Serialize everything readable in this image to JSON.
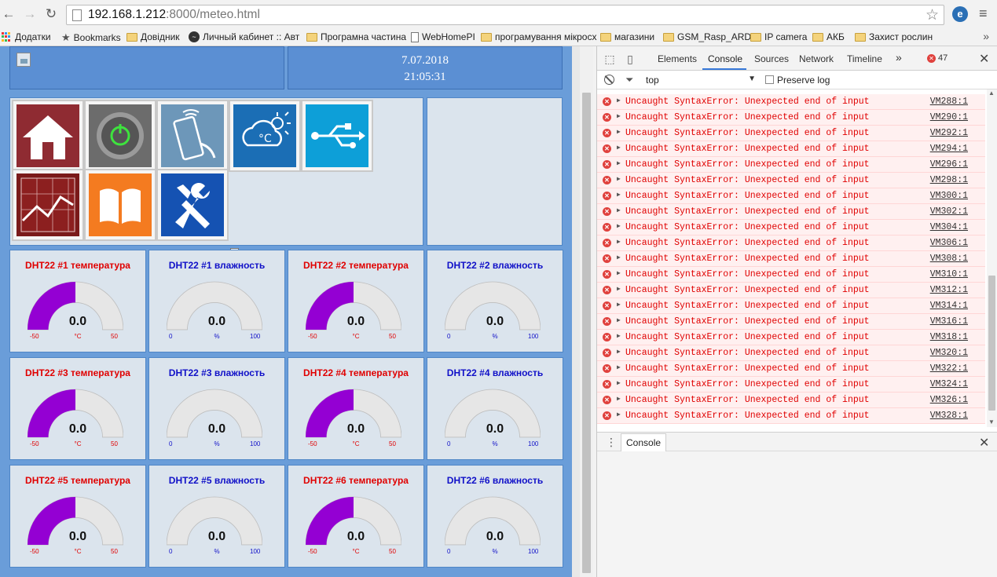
{
  "browser": {
    "url_host": "192.168.1.212",
    "url_rest": ":8000/meteo.html",
    "bookmarks": [
      {
        "label": "Додатки",
        "icon": "apps-icon"
      },
      {
        "label": "Bookmarks",
        "icon": "star-icon"
      },
      {
        "label": "Довідник",
        "icon": "folder-icon"
      },
      {
        "label": "Личный кабинет :: Авт",
        "icon": "globe-icon"
      },
      {
        "label": "Програмна частина",
        "icon": "folder-icon"
      },
      {
        "label": "WebHomePI",
        "icon": "page-icon"
      },
      {
        "label": "програмування мікросх",
        "icon": "folder-icon"
      },
      {
        "label": "магазини",
        "icon": "folder-icon"
      },
      {
        "label": "GSM_Rasp_ARD",
        "icon": "folder-icon"
      },
      {
        "label": "IP camera",
        "icon": "folder-icon"
      },
      {
        "label": "АКБ",
        "icon": "folder-icon"
      },
      {
        "label": "Захист рослин",
        "icon": "folder-icon"
      }
    ],
    "more_bookmarks": "»"
  },
  "page": {
    "date": "7.07.2018",
    "time": "21:05:31",
    "tiles": [
      {
        "name": "home",
        "color": "#8f2b32"
      },
      {
        "name": "power",
        "color": "#6c6c6c"
      },
      {
        "name": "remote",
        "color": "#6d97b9"
      },
      {
        "name": "weather",
        "color": "#1b6eb5"
      },
      {
        "name": "usb",
        "color": "#0d9fd8"
      },
      {
        "name": "chart",
        "color": "#7a1a1a"
      },
      {
        "name": "book",
        "color": "#f47b20"
      },
      {
        "name": "tools",
        "color": "#1552b2"
      }
    ],
    "gauges": [
      {
        "title": "DHT22 #1 температура",
        "kind": "temp",
        "value": "0.0",
        "min": "-50",
        "max": "50",
        "unit": "°C",
        "fill": 0.5
      },
      {
        "title": "DHT22 #1 влажность",
        "kind": "hum",
        "value": "0.0",
        "min": "0",
        "max": "100",
        "unit": "%",
        "fill": 0.0
      },
      {
        "title": "DHT22 #2 температура",
        "kind": "temp",
        "value": "0.0",
        "min": "-50",
        "max": "50",
        "unit": "°C",
        "fill": 0.5
      },
      {
        "title": "DHT22 #2 влажность",
        "kind": "hum",
        "value": "0.0",
        "min": "0",
        "max": "100",
        "unit": "%",
        "fill": 0.0
      },
      {
        "title": "DHT22 #3 температура",
        "kind": "temp",
        "value": "0.0",
        "min": "-50",
        "max": "50",
        "unit": "°C",
        "fill": 0.5
      },
      {
        "title": "DHT22 #3 влажность",
        "kind": "hum",
        "value": "0.0",
        "min": "0",
        "max": "100",
        "unit": "%",
        "fill": 0.0
      },
      {
        "title": "DHT22 #4 температура",
        "kind": "temp",
        "value": "0.0",
        "min": "-50",
        "max": "50",
        "unit": "°C",
        "fill": 0.5
      },
      {
        "title": "DHT22 #4 влажность",
        "kind": "hum",
        "value": "0.0",
        "min": "0",
        "max": "100",
        "unit": "%",
        "fill": 0.0
      },
      {
        "title": "DHT22 #5 температура",
        "kind": "temp",
        "value": "0.0",
        "min": "-50",
        "max": "50",
        "unit": "°C",
        "fill": 0.5
      },
      {
        "title": "DHT22 #5 влажность",
        "kind": "hum",
        "value": "0.0",
        "min": "0",
        "max": "100",
        "unit": "%",
        "fill": 0.0
      },
      {
        "title": "DHT22 #6 температура",
        "kind": "temp",
        "value": "0.0",
        "min": "-50",
        "max": "50",
        "unit": "°C",
        "fill": 0.5
      },
      {
        "title": "DHT22 #6 влажность",
        "kind": "hum",
        "value": "0.0",
        "min": "0",
        "max": "100",
        "unit": "%",
        "fill": 0.0
      }
    ],
    "colors": {
      "gauge_fill": "#9400d3",
      "gauge_empty": "#e6e6e6"
    }
  },
  "devtools": {
    "tabs": [
      "Elements",
      "Console",
      "Sources",
      "Network",
      "Timeline"
    ],
    "active_tab": "Console",
    "more_tabs": "»",
    "error_count": "47",
    "context": "top",
    "preserve_log_label": "Preserve log",
    "messages": [
      {
        "text": "Uncaught SyntaxError: Unexpected end of input",
        "source": "VM288:1"
      },
      {
        "text": "Uncaught SyntaxError: Unexpected end of input",
        "source": "VM290:1"
      },
      {
        "text": "Uncaught SyntaxError: Unexpected end of input",
        "source": "VM292:1"
      },
      {
        "text": "Uncaught SyntaxError: Unexpected end of input",
        "source": "VM294:1"
      },
      {
        "text": "Uncaught SyntaxError: Unexpected end of input",
        "source": "VM296:1"
      },
      {
        "text": "Uncaught SyntaxError: Unexpected end of input",
        "source": "VM298:1"
      },
      {
        "text": "Uncaught SyntaxError: Unexpected end of input",
        "source": "VM300:1"
      },
      {
        "text": "Uncaught SyntaxError: Unexpected end of input",
        "source": "VM302:1"
      },
      {
        "text": "Uncaught SyntaxError: Unexpected end of input",
        "source": "VM304:1"
      },
      {
        "text": "Uncaught SyntaxError: Unexpected end of input",
        "source": "VM306:1"
      },
      {
        "text": "Uncaught SyntaxError: Unexpected end of input",
        "source": "VM308:1"
      },
      {
        "text": "Uncaught SyntaxError: Unexpected end of input",
        "source": "VM310:1"
      },
      {
        "text": "Uncaught SyntaxError: Unexpected end of input",
        "source": "VM312:1"
      },
      {
        "text": "Uncaught SyntaxError: Unexpected end of input",
        "source": "VM314:1"
      },
      {
        "text": "Uncaught SyntaxError: Unexpected end of input",
        "source": "VM316:1"
      },
      {
        "text": "Uncaught SyntaxError: Unexpected end of input",
        "source": "VM318:1"
      },
      {
        "text": "Uncaught SyntaxError: Unexpected end of input",
        "source": "VM320:1"
      },
      {
        "text": "Uncaught SyntaxError: Unexpected end of input",
        "source": "VM322:1"
      },
      {
        "text": "Uncaught SyntaxError: Unexpected end of input",
        "source": "VM324:1"
      },
      {
        "text": "Uncaught SyntaxError: Unexpected end of input",
        "source": "VM326:1"
      },
      {
        "text": "Uncaught SyntaxError: Unexpected end of input",
        "source": "VM328:1"
      }
    ],
    "drawer_tab": "Console"
  }
}
